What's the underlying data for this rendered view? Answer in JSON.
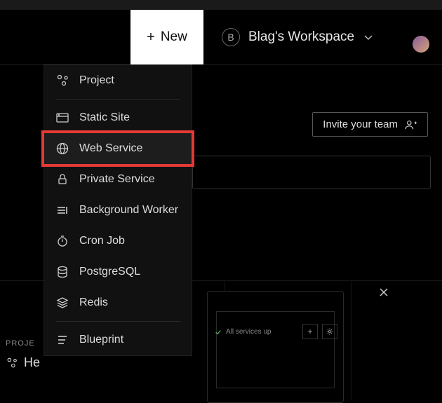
{
  "header": {
    "new_label": "New",
    "workspace_initial": "B",
    "workspace_name": "Blag's Workspace"
  },
  "menu": {
    "items": [
      {
        "id": "project",
        "label": "Project"
      },
      {
        "id": "static-site",
        "label": "Static Site"
      },
      {
        "id": "web-service",
        "label": "Web Service",
        "selected": true
      },
      {
        "id": "private-service",
        "label": "Private Service"
      },
      {
        "id": "background-worker",
        "label": "Background Worker"
      },
      {
        "id": "cron-job",
        "label": "Cron Job"
      },
      {
        "id": "postgresql",
        "label": "PostgreSQL"
      },
      {
        "id": "redis",
        "label": "Redis"
      },
      {
        "id": "blueprint",
        "label": "Blueprint"
      }
    ]
  },
  "invite_label": "Invite your team",
  "projects": {
    "section_label": "PROJE",
    "item_label": "He"
  },
  "panel": {
    "status": "All services up"
  },
  "colors": {
    "highlight": "#e53935",
    "bg": "#000"
  }
}
